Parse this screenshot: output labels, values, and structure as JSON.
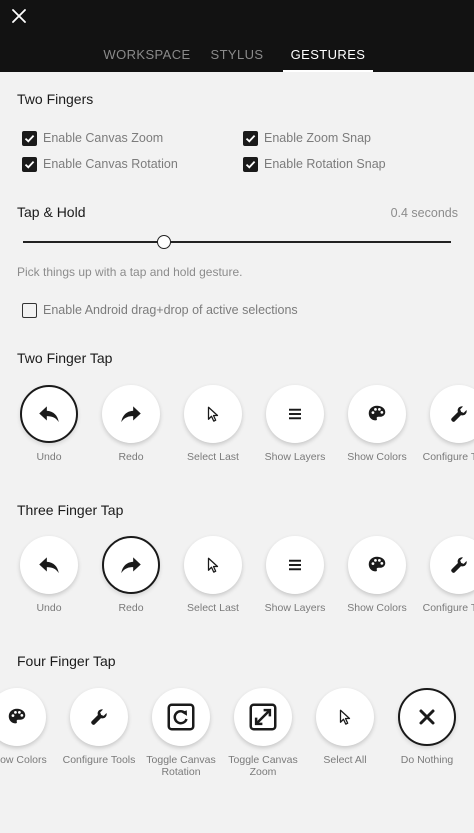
{
  "header": {
    "tabs": [
      {
        "label": "WORKSPACE",
        "active": false
      },
      {
        "label": "STYLUS",
        "active": false
      },
      {
        "label": "GESTURES",
        "active": true
      }
    ]
  },
  "two_fingers": {
    "title": "Two Fingers",
    "options": [
      {
        "label": "Enable Canvas Zoom",
        "checked": true
      },
      {
        "label": "Enable Zoom Snap",
        "checked": true
      },
      {
        "label": "Enable Canvas Rotation",
        "checked": true
      },
      {
        "label": "Enable Rotation Snap",
        "checked": true
      }
    ]
  },
  "tap_hold": {
    "title": "Tap & Hold",
    "value_text": "0.4 seconds",
    "slider_fraction": 0.33,
    "hint": "Pick things up with a tap and hold gesture.",
    "android_option": {
      "label": "Enable Android drag+drop of active selections",
      "checked": false
    }
  },
  "two_finger_tap": {
    "title": "Two Finger Tap",
    "actions": [
      {
        "label": "Undo",
        "icon": "undo-icon",
        "selected": true
      },
      {
        "label": "Redo",
        "icon": "redo-icon",
        "selected": false
      },
      {
        "label": "Select Last",
        "icon": "cursor-icon",
        "selected": false
      },
      {
        "label": "Show Layers",
        "icon": "layers-icon",
        "selected": false
      },
      {
        "label": "Show Colors",
        "icon": "palette-icon",
        "selected": false
      },
      {
        "label": "Configure Tools",
        "icon": "wrench-icon",
        "selected": false
      }
    ]
  },
  "three_finger_tap": {
    "title": "Three Finger Tap",
    "actions": [
      {
        "label": "Undo",
        "icon": "undo-icon",
        "selected": false
      },
      {
        "label": "Redo",
        "icon": "redo-icon",
        "selected": true
      },
      {
        "label": "Select Last",
        "icon": "cursor-icon",
        "selected": false
      },
      {
        "label": "Show Layers",
        "icon": "layers-icon",
        "selected": false
      },
      {
        "label": "Show Colors",
        "icon": "palette-icon",
        "selected": false
      },
      {
        "label": "Configure Tools",
        "icon": "wrench-icon",
        "selected": false
      }
    ]
  },
  "four_finger_tap": {
    "title": "Four Finger Tap",
    "actions": [
      {
        "label": "Show Colors",
        "icon": "palette-icon",
        "selected": false
      },
      {
        "label": "Configure Tools",
        "icon": "wrench-icon",
        "selected": false
      },
      {
        "label": "Toggle Canvas Rotation",
        "icon": "rotate-icon",
        "selected": false
      },
      {
        "label": "Toggle Canvas Zoom",
        "icon": "expand-icon",
        "selected": false
      },
      {
        "label": "Select All",
        "icon": "cursor-icon",
        "selected": false
      },
      {
        "label": "Do Nothing",
        "icon": "x-icon",
        "selected": true
      }
    ]
  }
}
